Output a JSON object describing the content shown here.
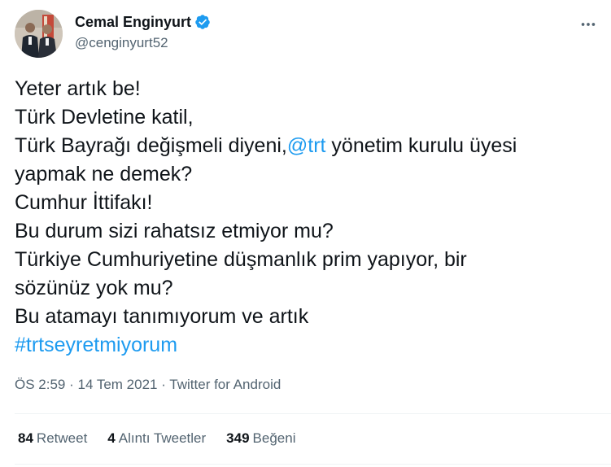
{
  "author": {
    "display_name": "Cemal Enginyurt",
    "handle": "@cenginyurt52",
    "verified": true,
    "avatar": "profile-photo"
  },
  "tweet": {
    "lines": [
      {
        "text": "Yeter artık be!"
      },
      {
        "text": "Türk Devletine katil,"
      },
      {
        "before": "Türk Bayrağı değişmeli diyeni,",
        "mention": "@trt",
        "after": " yönetim kurulu üyesi"
      },
      {
        "text": "yapmak ne demek?"
      },
      {
        "text": "Cumhur İttifakı!"
      },
      {
        "text": "Bu durum sizi rahatsız etmiyor mu?"
      },
      {
        "text": "Türkiye Cumhuriyetine düşmanlık prim yapıyor, bir"
      },
      {
        "text": "sözünüz yok mu?"
      },
      {
        "text": "Bu atamayı tanımıyorum ve artık"
      }
    ],
    "hashtag": "#trtseyretmiyorum"
  },
  "meta": {
    "time": "ÖS 2:59",
    "date": "14 Tem 2021",
    "source": "Twitter for Android",
    "separator": "·"
  },
  "stats": {
    "retweets_count": "84",
    "retweets_label": "Retweet",
    "quotes_count": "4",
    "quotes_label": "Alıntı Tweetler",
    "likes_count": "349",
    "likes_label": "Beğeni"
  },
  "colors": {
    "link": "#1d9bf0",
    "verified_badge": "#1d9bf0",
    "secondary_text": "#536471",
    "primary_text": "#0f1419",
    "divider": "#eff3f4"
  },
  "icons": [
    "verified-badge-icon",
    "more-options-icon"
  ]
}
